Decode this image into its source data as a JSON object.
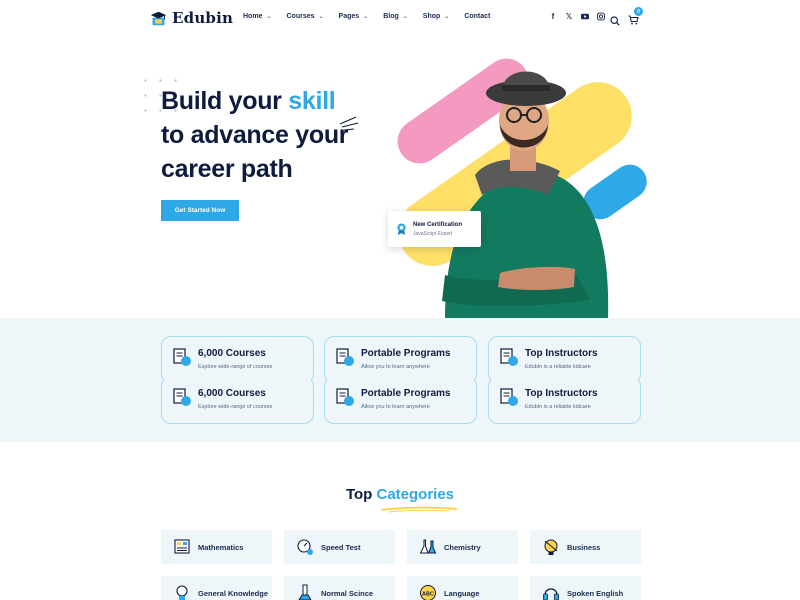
{
  "brand": {
    "name": "Edubin",
    "accent": "#2ea8e6",
    "dark": "#0f1b3d"
  },
  "nav": [
    {
      "label": "Home",
      "dropdown": true
    },
    {
      "label": "Courses",
      "dropdown": true
    },
    {
      "label": "Pages",
      "dropdown": true
    },
    {
      "label": "Blog",
      "dropdown": true
    },
    {
      "label": "Shop",
      "dropdown": true
    },
    {
      "label": "Contact",
      "dropdown": false
    }
  ],
  "socials": [
    "facebook-icon",
    "x-icon",
    "youtube-icon",
    "instagram-icon"
  ],
  "cart": {
    "count": "0"
  },
  "hero": {
    "line1_a": "Build your ",
    "line1_b": "skill",
    "line2": "to advance your",
    "line3": "career path",
    "cta": "Get Started Now"
  },
  "certificate": {
    "title": "New Certification",
    "subtitle": "JavaScript Expert"
  },
  "features": [
    {
      "title": "6,000 Courses",
      "subtitle": "Explore wide-range of courses"
    },
    {
      "title": "Portable Programs",
      "subtitle": "Allow you to learn anywhere"
    },
    {
      "title": "Top Instructors",
      "subtitle": "Edubin is a reliable kidcare"
    },
    {
      "title": "6,000 Courses",
      "subtitle": "Explore wide-range of courses"
    },
    {
      "title": "Portable Programs",
      "subtitle": "Allow you to learn anywhere"
    },
    {
      "title": "Top Instructors",
      "subtitle": "Edubin is a reliable kidcare"
    }
  ],
  "categories_section": {
    "title_a": "Top ",
    "title_b": "Categories"
  },
  "categories": [
    {
      "label": "Mathematics",
      "icon": "math-icon"
    },
    {
      "label": "Speed Test",
      "icon": "speed-test-icon"
    },
    {
      "label": "Chemistry",
      "icon": "chemistry-icon"
    },
    {
      "label": "Business",
      "icon": "business-icon"
    },
    {
      "label": "General Knowledge",
      "icon": "knowledge-icon"
    },
    {
      "label": "Normal Scince",
      "icon": "science-icon"
    },
    {
      "label": "Language",
      "icon": "language-icon"
    },
    {
      "label": "Spoken English",
      "icon": "headphones-icon"
    }
  ]
}
